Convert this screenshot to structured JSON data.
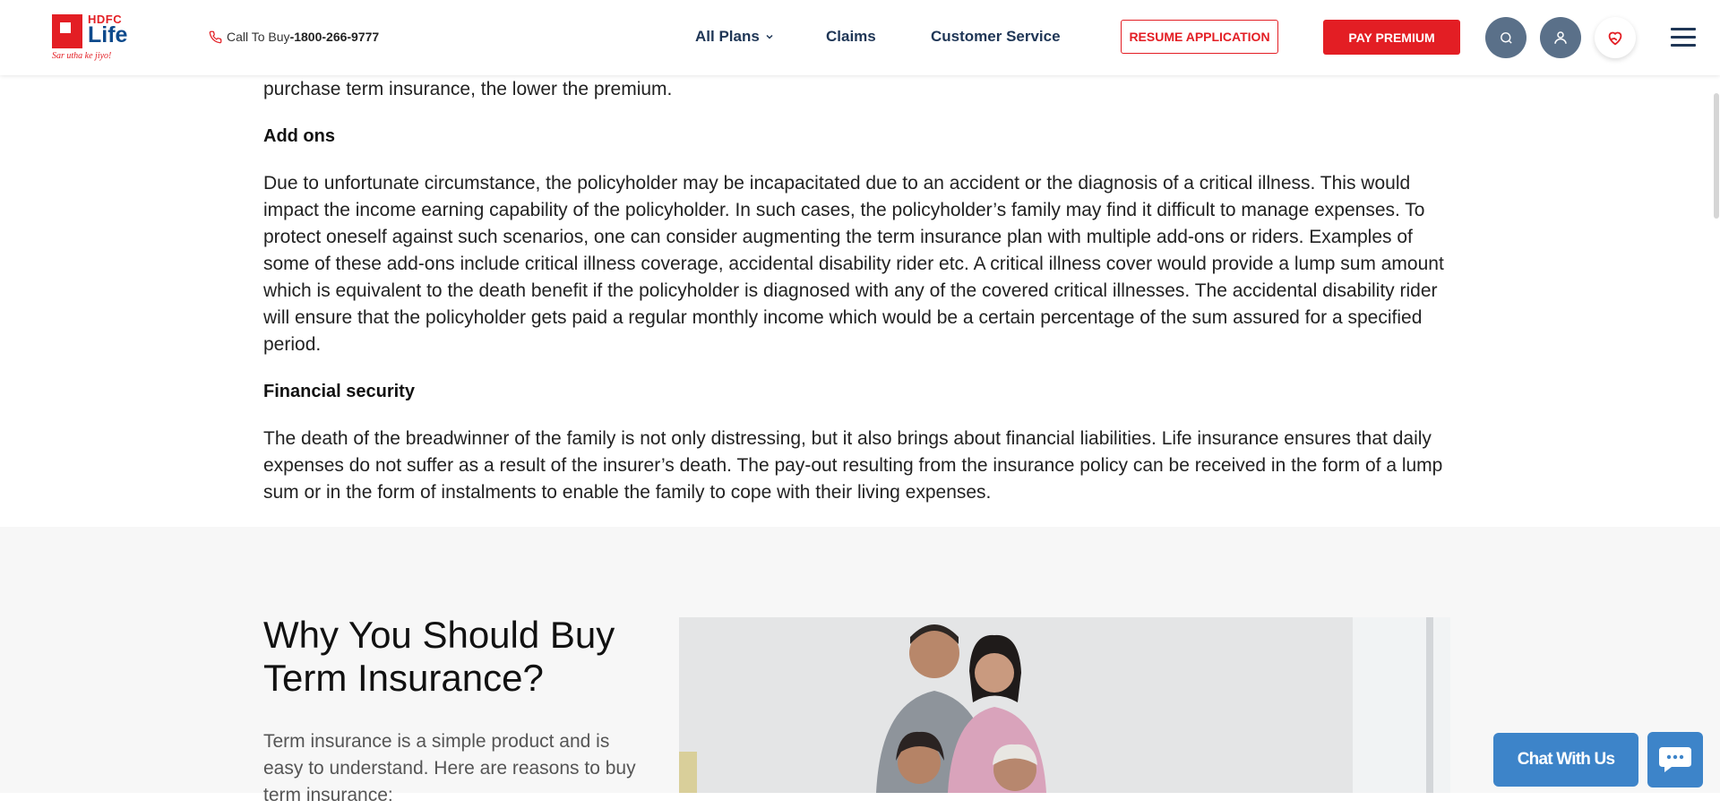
{
  "header": {
    "logo": {
      "brand_top": "HDFC",
      "brand_main": "Life",
      "tagline": "Sar utha ke jiyo!"
    },
    "call": {
      "prefix": "Call To Buy",
      "number": "-1800-266-9777"
    },
    "nav": {
      "all_plans": "All Plans",
      "claims": "Claims",
      "customer_service": "Customer Service"
    },
    "buttons": {
      "resume": "RESUME APPLICATION",
      "pay": "PAY PREMIUM"
    },
    "icons": [
      "phone-icon",
      "chevron-down-icon",
      "search-icon",
      "user-icon",
      "heart-hand-icon",
      "menu-icon"
    ],
    "colors": {
      "brand_red": "#e31e24",
      "nav_blue": "#1f3656",
      "icon_slate": "#5a7089"
    }
  },
  "article": {
    "intro_tail": "purchase term insurance, the lower the premium.",
    "sections": [
      {
        "heading": "Add ons",
        "body": "Due to unfortunate circumstance, the policyholder may be incapacitated due to an accident or the diagnosis of a critical illness. This would impact the income earning capability of the policyholder. In such cases, the policyholder’s family may find it difficult to manage expenses. To protect oneself against such scenarios, one can consider augmenting the term insurance plan with multiple add-ons or riders. Examples of some of these add-ons include critical illness coverage, accidental disability rider etc. A critical illness cover would provide a lump sum amount which is equivalent to the death benefit if the policyholder is diagnosed with any of the covered critical illnesses. The accidental disability rider will ensure that the policyholder gets paid a regular monthly income which would be a certain percentage of the sum assured for a specified period."
      },
      {
        "heading": "Financial security",
        "body": "The death of the breadwinner of the family is not only distressing, but it also brings about financial liabilities. Life insurance ensures that daily expenses do not suffer as a result of the insurer’s death. The pay-out resulting from the insurance policy can be received in the form of a lump sum or in the form of instalments to enable the family to cope with their living expenses."
      }
    ]
  },
  "why": {
    "title": "Why You Should Buy Term Insurance?",
    "desc": "Term insurance is a simple product and is easy to understand. Here are reasons to buy term insurance:"
  },
  "chat": {
    "label": "Chat With Us",
    "icon": "chat-bubble-icon",
    "color": "#3d84c9"
  }
}
